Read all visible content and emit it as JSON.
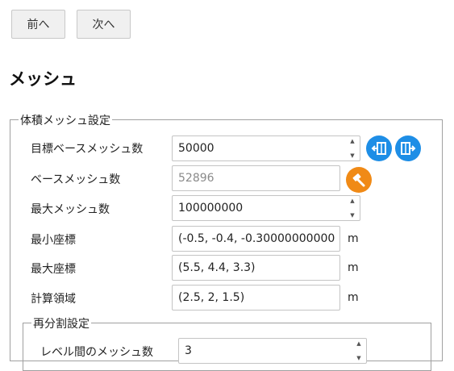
{
  "nav": {
    "prev_label": "前へ",
    "next_label": "次へ"
  },
  "page": {
    "title": "メッシュ"
  },
  "volume_mesh": {
    "legend": "体積メッシュ設定",
    "target_base_mesh": {
      "label": "目標ベースメッシュ数",
      "value": "50000"
    },
    "base_mesh": {
      "label": "ベースメッシュ数",
      "value": "52896"
    },
    "max_mesh": {
      "label": "最大メッシュ数",
      "value": "100000000"
    },
    "min_coord": {
      "label": "最小座標",
      "value": "(-0.5, -0.4, -0.30000000000",
      "unit": "m"
    },
    "max_coord": {
      "label": "最大座標",
      "value": "(5.5, 4.4, 3.3)",
      "unit": "m"
    },
    "domain": {
      "label": "計算領域",
      "value": "(2.5, 2, 1.5)",
      "unit": "m"
    }
  },
  "refinement": {
    "legend": "再分割設定",
    "cells_between_levels": {
      "label": "レベル間のメッシュ数",
      "value": "3"
    }
  },
  "colors": {
    "accent_blue": "#1e8ee6",
    "accent_orange": "#f08a16"
  },
  "icons": [
    "import-icon",
    "export-icon",
    "hammer-icon",
    "spinner-up-icon",
    "spinner-down-icon"
  ]
}
